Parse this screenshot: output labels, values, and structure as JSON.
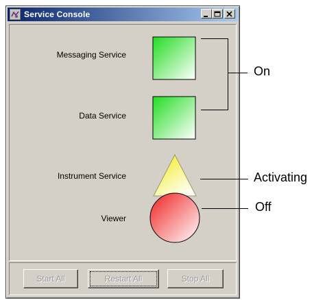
{
  "window": {
    "title": "Service Console"
  },
  "services": [
    {
      "label": "Messaging Service",
      "indicator": "green-square",
      "status": "On"
    },
    {
      "label": "Data Service",
      "indicator": "green-square",
      "status": "On"
    },
    {
      "label": "Instrument Service",
      "indicator": "yellow-triangle",
      "status": "Activating"
    },
    {
      "label": "Viewer",
      "indicator": "red-circle",
      "status": "Off"
    }
  ],
  "buttons": {
    "start_all": "Start All",
    "restart_all": "Restart All",
    "stop_all": "Stop All"
  },
  "annotations": {
    "on": "On",
    "activating": "Activating",
    "off": "Off"
  },
  "colors": {
    "on": "#22dd22",
    "activating": "#f4f060",
    "off": "#ee2222",
    "window_bg": "#d4d0c8",
    "titlebar": "#0a246a"
  }
}
